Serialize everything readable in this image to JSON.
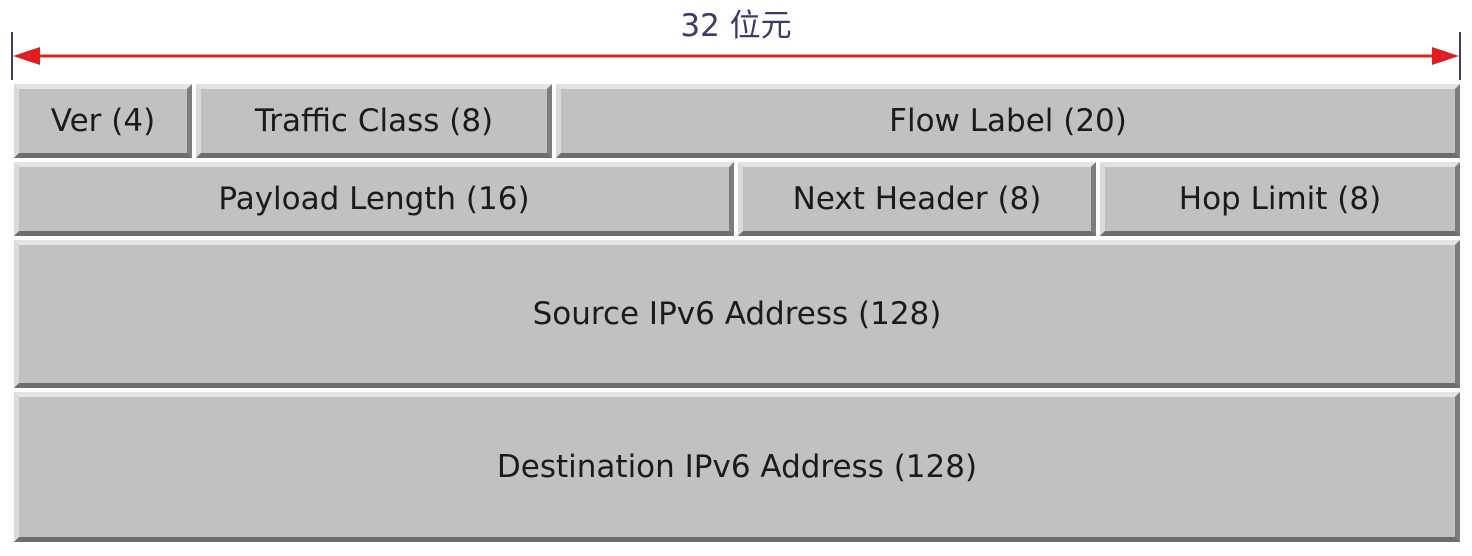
{
  "width_label": "32 位元",
  "rows": [
    {
      "fields": [
        {
          "label": "Ver (4)"
        },
        {
          "label": "Traffic Class (8)"
        },
        {
          "label": "Flow Label (20)"
        }
      ]
    },
    {
      "fields": [
        {
          "label": "Payload Length (16)"
        },
        {
          "label": "Next Header (8)"
        },
        {
          "label": "Hop Limit (8)"
        }
      ]
    },
    {
      "fields": [
        {
          "label": "Source IPv6 Address (128)"
        }
      ]
    },
    {
      "fields": [
        {
          "label": "Destination IPv6 Address (128)"
        }
      ]
    }
  ],
  "colors": {
    "arrow": "#e02020",
    "arrow_ticks": "#3a3a6e",
    "label_text": "#3a3a6e",
    "field_fill": "#c1c1c1"
  }
}
